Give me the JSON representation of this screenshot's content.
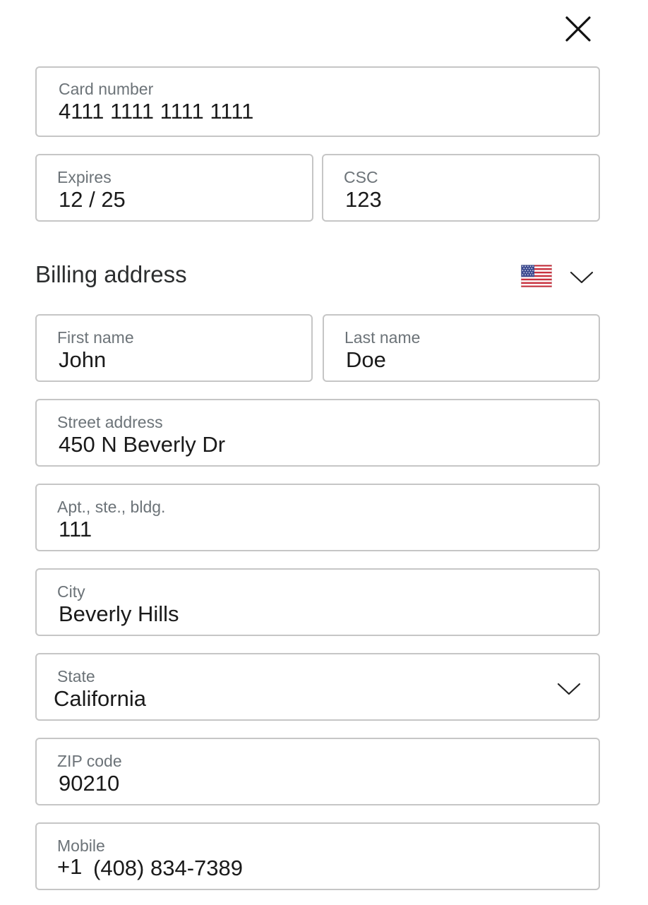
{
  "card": {
    "number_label": "Card number",
    "number_value": "4111 1111 1111 1111",
    "expires_label": "Expires",
    "expires_value": "12 / 25",
    "csc_label": "CSC",
    "csc_value": "123"
  },
  "billing": {
    "title": "Billing address",
    "country_flag_icon": "us-flag-icon",
    "first_name_label": "First name",
    "first_name_value": "John",
    "last_name_label": "Last name",
    "last_name_value": "Doe",
    "street_label": "Street address",
    "street_value": "450 N Beverly Dr",
    "apt_label": "Apt., ste., bldg.",
    "apt_value": "111",
    "city_label": "City",
    "city_value": "Beverly Hills",
    "state_label": "State",
    "state_value": "California",
    "zip_label": "ZIP code",
    "zip_value": "90210",
    "mobile_label": "Mobile",
    "mobile_prefix": "+1",
    "mobile_value": "(408) 834-7389"
  },
  "icons": {
    "close": "close-icon",
    "chevron": "chevron-down-icon"
  },
  "colors": {
    "border": "#c6c6c6",
    "label": "#6c7378",
    "text": "#1a1a1a"
  }
}
